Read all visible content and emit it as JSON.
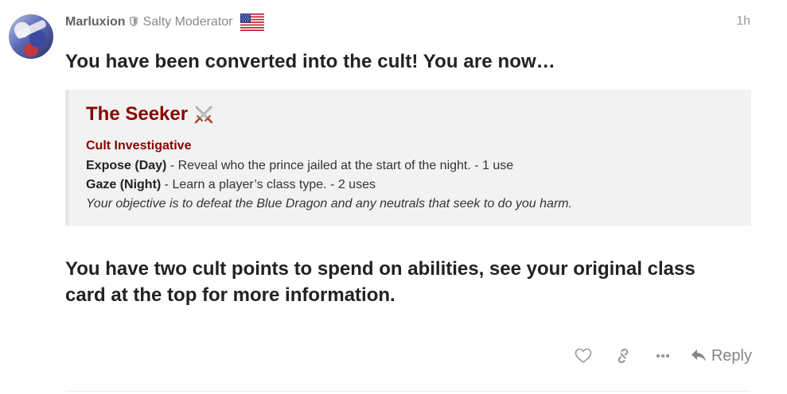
{
  "post": {
    "username": "Marluxion",
    "user_title": "Salty Moderator",
    "age": "1h",
    "heading": "You have been converted into the cult! You are now…",
    "role_card": {
      "title": "The Seeker",
      "type": "Cult Investigative",
      "abilities": [
        {
          "name": "Expose (Day)",
          "description": " - Reveal who the prince jailed at the start of the night. - 1 use"
        },
        {
          "name": "Gaze (Night)",
          "description": " - Learn a player’s class type. - 2 uses"
        }
      ],
      "objective": "Your objective is to defeat the Blue Dragon and any neutrals that seek to do you harm."
    },
    "footer_text": "You have two cult points to spend on abilities, see your original class card at the top for more information."
  },
  "actions": {
    "reply_label": "Reply"
  },
  "icons": [
    "avatar",
    "shield-icon",
    "us-flag-icon",
    "crossed-swords-icon",
    "heart-icon",
    "link-icon",
    "more-icon",
    "reply-icon"
  ],
  "colors": {
    "role_accent": "#8b0000",
    "quote_bg": "#f2f2f2",
    "muted": "#858585"
  }
}
